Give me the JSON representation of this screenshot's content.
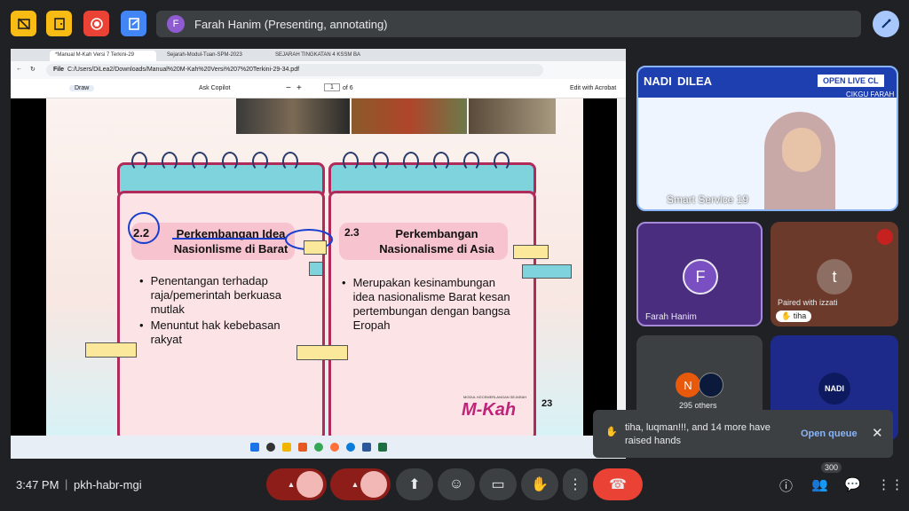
{
  "top": {
    "presenter_initial": "F",
    "presenter_label": "Farah Hanim (Presenting, annotating)"
  },
  "browser": {
    "tabs": [
      "*Manual M-Kah Versi 7 Terkini-29",
      "Sejarah-Modul-Tuan-SPM-2023",
      "SEJARAH TINGKATAN 4 KSSM BA"
    ],
    "url_prefix": "File",
    "url": "C:/Users/DiLea2/Downloads/Manual%20M-Kah%20Versi%207%20Terkini-29-34.pdf",
    "pdf_toolbar": {
      "draw": "Draw",
      "ask": "Ask Copilot",
      "zoom_minus": "−",
      "zoom_plus": "+",
      "page": "1",
      "of": "of 6",
      "edit": "Edit with Acrobat"
    }
  },
  "slide": {
    "left": {
      "number": "2.2",
      "title1": "Perkembangan Idea",
      "title2": "Nasionlisme di Barat",
      "bullets": [
        "Penentangan terhadap raja/pemerintah berkuasa mutlak",
        "Menuntut hak kebebasan rakyat"
      ]
    },
    "right": {
      "number": "2.3",
      "title1": "Perkembangan",
      "title2": "Nasionalisme di Asia",
      "bullets": [
        "Merupakan kesinambungan idea nasionalisme Barat kesan pertembungan dengan bangsa Eropah"
      ]
    },
    "footer_small": "MODUL KECEMERLANGAN SEJARAH",
    "logo": "M-Kah",
    "page_no": "23"
  },
  "tiles": {
    "live": {
      "brand1": "NADI",
      "brand2": "DILEA",
      "banner": "OPEN LIVE CL",
      "teacher": "CIKGU FARAH",
      "name": "Smart Service 19"
    },
    "farah": {
      "initial": "F",
      "name": "Farah Hanim"
    },
    "t": {
      "initial": "t",
      "paired": "Paired with izzati",
      "hand": "tiha"
    },
    "others": {
      "initial": "N",
      "count": "295 others"
    },
    "nadi": {
      "label": "NADI"
    }
  },
  "toast": {
    "text": "tiha, luqman!!!, and 14 more have raised hands",
    "action": "Open queue"
  },
  "bottom": {
    "time": "3:47 PM",
    "code": "pkh-habr-mgi",
    "people_count": "300"
  }
}
